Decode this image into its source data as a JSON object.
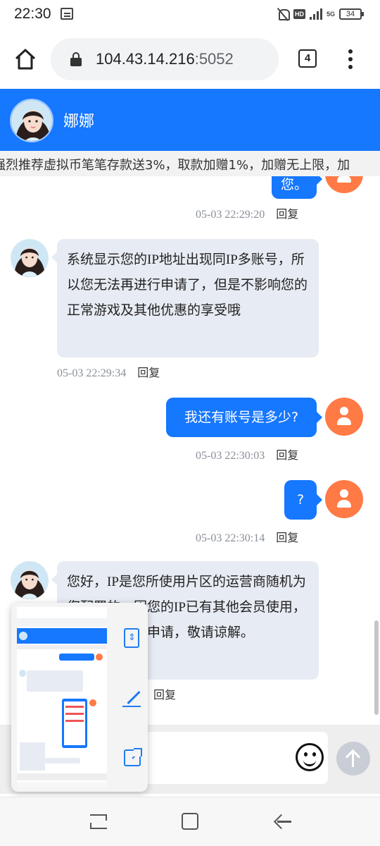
{
  "status_bar": {
    "time": "22:30",
    "network_badge": "HD",
    "network_type": "5G",
    "battery": "34"
  },
  "browser": {
    "url_host": "104.43.14.216",
    "url_port": ":5052",
    "tab_count": "4"
  },
  "chat": {
    "agent_name": "娜娜",
    "marquee": "强烈推荐虚拟币笔笔存款送3%，取款加赠1%，加赠无上限，加",
    "reply_label": "回复",
    "messages": [
      {
        "from": "user",
        "text": "您。",
        "time": "05-03 22:29:20"
      },
      {
        "from": "agent",
        "text": "系统显示您的IP地址出现同IP多账号，所以您无法再进行申请了，但是不影响您的正常游戏及其他优惠的享受哦",
        "time": "05-03 22:29:34"
      },
      {
        "from": "user",
        "text": "我还有账号是多少?",
        "time": "05-03 22:30:03"
      },
      {
        "from": "user",
        "text": "?",
        "time": "05-03 22:30:14"
      },
      {
        "from": "agent",
        "text": "您好，IP是您所使用片区的运营商随机为您配置的，因您的IP已有其他会员使用，所以无法为您申请，敬请谅解。",
        "time": ""
      }
    ]
  },
  "colors": {
    "header": "#1677ff",
    "user_avatar": "#ff7a45",
    "agent_bubble": "#e7ebf3"
  }
}
